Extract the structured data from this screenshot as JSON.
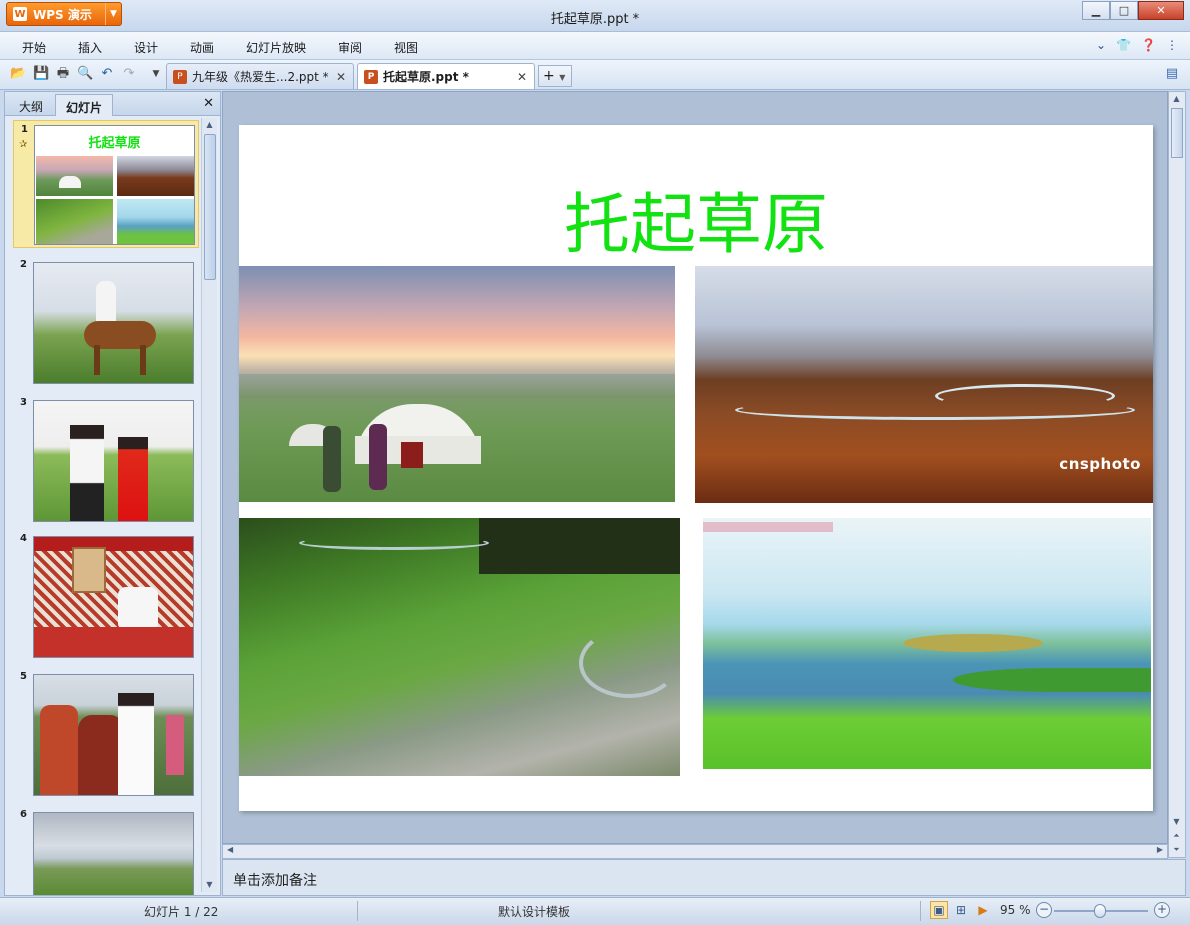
{
  "window": {
    "app_button": "WPS 演示",
    "title": "托起草原.ppt *"
  },
  "menu": [
    "开始",
    "插入",
    "设计",
    "动画",
    "幻灯片放映",
    "审阅",
    "视图"
  ],
  "tabs": [
    {
      "label": "九年级《热爱生...2.ppt *",
      "active": false
    },
    {
      "label": "托起草原.ppt *",
      "active": true
    }
  ],
  "left_pane": {
    "tabs": [
      "大纲",
      "幻灯片"
    ],
    "active_tab": "幻灯片",
    "thumbnails": [
      {
        "num": "1",
        "title": "托起草原"
      },
      {
        "num": "2"
      },
      {
        "num": "3"
      },
      {
        "num": "4"
      },
      {
        "num": "5"
      },
      {
        "num": "6"
      }
    ]
  },
  "slide": {
    "title": "托起草原",
    "watermark": "cnsphoto",
    "title_color": "#12e112"
  },
  "notes": {
    "placeholder": "单击添加备注"
  },
  "status": {
    "slide_counter": "幻灯片 1 / 22",
    "template": "默认设计模板",
    "zoom": "95 %"
  },
  "icons": {
    "toolbar": [
      "open-icon",
      "save-icon",
      "print-icon",
      "print-preview-icon",
      "undo-icon",
      "redo-icon",
      "customize-icon"
    ],
    "view": [
      "normal-view-icon",
      "slide-sorter-icon",
      "slideshow-icon"
    ]
  }
}
